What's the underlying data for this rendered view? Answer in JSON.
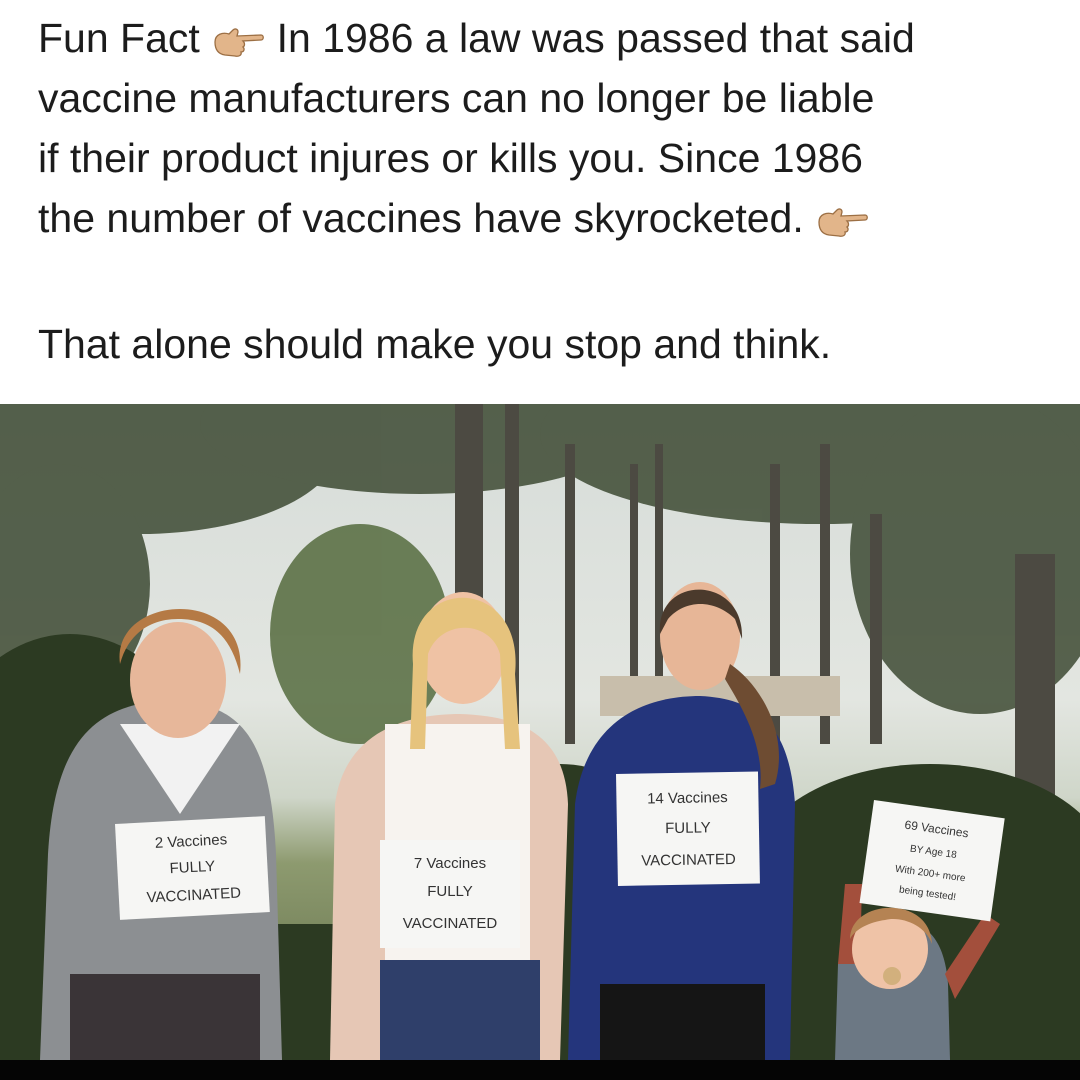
{
  "post": {
    "line1_before": "Fun Fact",
    "line1_after": "In 1986 a law was passed that said",
    "line2": "vaccine manufacturers can no longer be liable",
    "line3": "if their product injures or kills you. Since 1986",
    "line4": "the number of vaccines have skyrocketed.",
    "line5": "That alone should make you stop and think.",
    "icons": [
      "pointing-hand-right-icon",
      "pointing-hand-right-icon"
    ]
  },
  "photo": {
    "signs": [
      {
        "line1": "2 Vaccines",
        "line2": "FULLY",
        "line3": "VACCINATED"
      },
      {
        "line1": "7 Vaccines",
        "line2": "FULLY",
        "line3": "VACCINATED"
      },
      {
        "line1": "14 Vaccines",
        "line2": "FULLY",
        "line3": "VACCINATED"
      },
      {
        "line1": "69 Vaccines",
        "line2": "BY Age 18",
        "line3": "With 200+ more",
        "line4": "being tested!"
      }
    ]
  }
}
